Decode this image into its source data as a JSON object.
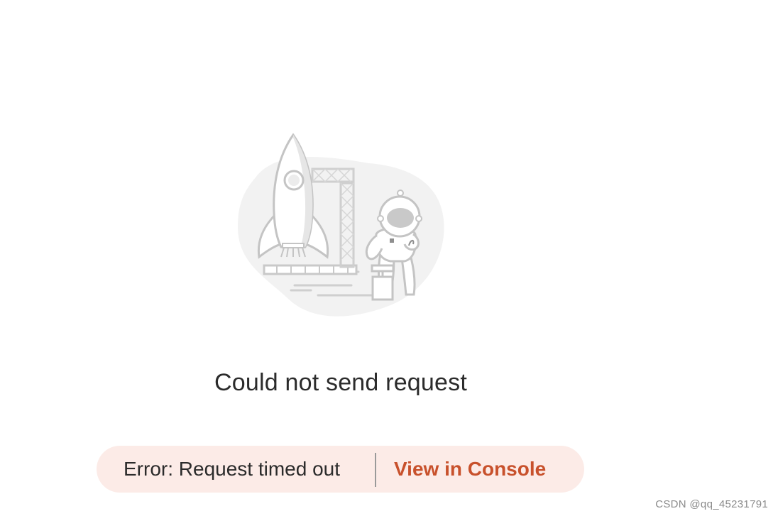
{
  "empty_state": {
    "illustration_icon": "rocket-launch-astronaut-illustration",
    "message": "Could not send request"
  },
  "error_bar": {
    "error_text": "Error: Request timed out",
    "action_label": "View in Console",
    "accent_color": "#c8512c",
    "background_color": "#fcebe7"
  },
  "watermark": {
    "text": "CSDN @qq_45231791"
  }
}
